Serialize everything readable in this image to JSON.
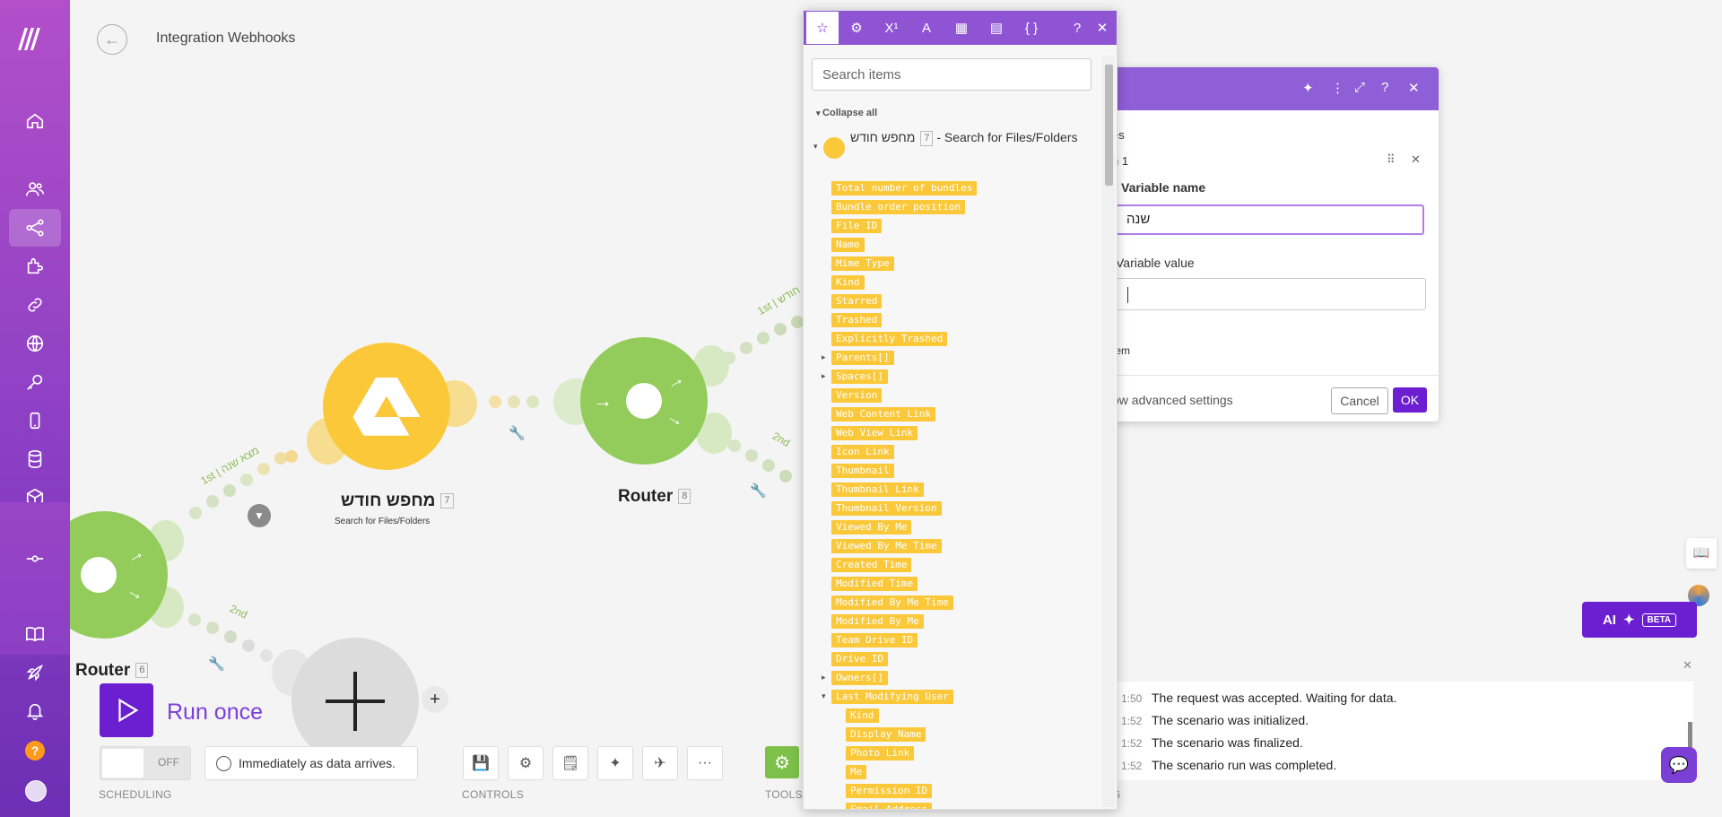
{
  "header": {
    "title": "Integration Webhooks"
  },
  "sidebar": {
    "items": [
      "home",
      "team",
      "scenarios",
      "apps",
      "connections",
      "webhooks",
      "keys",
      "devices",
      "datastores",
      "datastructures",
      "flow",
      "templates",
      "launch",
      "notifications"
    ],
    "help": "?"
  },
  "canvas": {
    "modules": [
      {
        "label": "מחפש חודש",
        "id": "7",
        "sub": "Search for Files/Folders"
      },
      {
        "label": "Router",
        "id": "8"
      },
      {
        "label": "Router",
        "id": "6"
      }
    ],
    "routes": {
      "r1": "1st | מצא שנה",
      "r2": "2nd",
      "r3": "1st | חודש",
      "r4": "2nd"
    }
  },
  "bottom": {
    "run_label": "Run once",
    "toggle_off": "OFF",
    "schedule": "Immediately as data arrives.",
    "scheduling_label": "SCHEDULING",
    "controls_label": "CONTROLS",
    "tools_label": "TOOLS",
    "log_label": "G"
  },
  "dialog": {
    "section1": "es",
    "item_label": "n 1",
    "var_name_label": "Variable name",
    "var_name_value": "שנה",
    "var_value_label": "Variable value",
    "add_item": "tem",
    "advanced": "ow advanced settings",
    "cancel": "Cancel",
    "ok": "OK"
  },
  "log": [
    {
      "time": "1:50",
      "text": "The request was accepted. Waiting for data."
    },
    {
      "time": "1:52",
      "text": "The scenario was initialized."
    },
    {
      "time": "1:52",
      "text": "The scenario was finalized."
    },
    {
      "time": "1:52",
      "text": "The scenario run was completed."
    }
  ],
  "ai": {
    "label": "AI",
    "beta": "BETA"
  },
  "mapper": {
    "search_placeholder": "Search items",
    "collapse_all": "Collapse all",
    "module_name": "מחפש חודש",
    "module_id": "7",
    "module_suffix": "- Search for Files/Folders",
    "items": [
      "Total number of bundles",
      "Bundle order position",
      "File ID",
      "Name",
      "Mime Type",
      "Kind",
      "Starred",
      "Trashed",
      "Explicitly Trashed",
      "Parents[]",
      "Spaces[]",
      "Version",
      "Web Content Link",
      "Web View Link",
      "Icon Link",
      "Thumbnail",
      "Thumbnail Link",
      "Thumbnail Version",
      "Viewed By Me",
      "Viewed By Me Time",
      "Created Time",
      "Modified Time",
      "Modified By Me Time",
      "Modified By Me",
      "Team Drive ID",
      "Drive ID",
      "Owners[]",
      "Last Modifying User"
    ],
    "subitems": [
      "Kind",
      "Display Name",
      "Photo Link",
      "Me",
      "Permission ID",
      "Email Address"
    ]
  }
}
